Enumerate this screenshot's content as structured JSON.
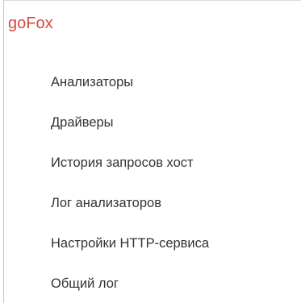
{
  "app": {
    "title": "goFox"
  },
  "menu": {
    "items": [
      {
        "label": "Анализаторы"
      },
      {
        "label": "Драйверы"
      },
      {
        "label": "История запросов хост"
      },
      {
        "label": "Лог анализаторов"
      },
      {
        "label": "Настройки HTTP-сервиса"
      },
      {
        "label": "Общий лог"
      }
    ]
  },
  "colors": {
    "title": "#d64a3f",
    "text": "#333333",
    "border": "#c6c6c6"
  }
}
